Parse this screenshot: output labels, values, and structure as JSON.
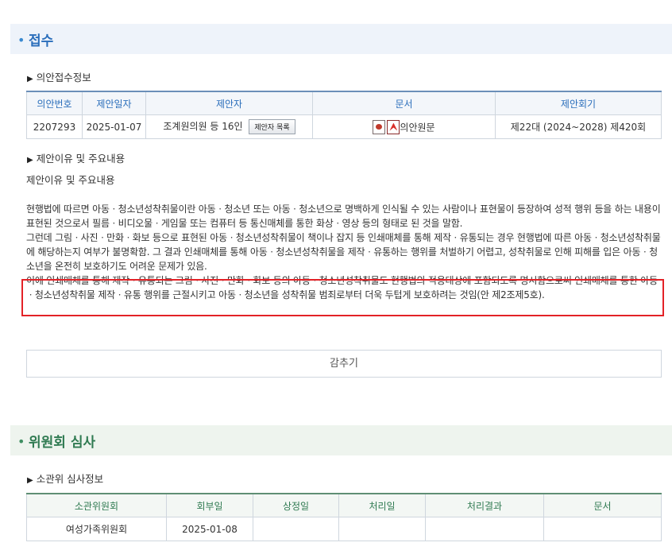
{
  "reception": {
    "heading": "접수",
    "subheading": "의안접수정보",
    "columns": [
      "의안번호",
      "제안일자",
      "제안자",
      "문서",
      "제안회기"
    ],
    "row": {
      "bill_no": "2207293",
      "date": "2025-01-07",
      "proposer": "조계원의원 등 16인",
      "proposer_btn": "제안자 목록",
      "document": "의안원문",
      "session": "제22대 (2024~2028) 제420회"
    }
  },
  "reason": {
    "subheading": "제안이유 및 주요내용",
    "label": "제안이유 및 주요내용",
    "para1": "현행법에 따르면 아동ㆍ청소년성착취물이란 아동ㆍ청소년 또는 아동ㆍ청소년으로 명백하게 인식될 수 있는 사람이나 표현물이 등장하여 성적 행위 등을 하는 내용이 표현된 것으로서 필름ㆍ비디오물ㆍ게임물 또는 컴퓨터 등 통신매체를 통한 화상ㆍ영상 등의 형태로 된 것을 말함.",
    "para2": "그런데 그림ㆍ사진ㆍ만화ㆍ화보 등으로 표현된 아동ㆍ청소년성착취물이 책이나 잡지 등 인쇄매체를 통해 제작ㆍ유통되는 경우 현행법에 따른 아동ㆍ청소년성착취물에 해당하는지 여부가 불명확함. 그 결과 인쇄매체를 통해 아동ㆍ청소년성착취물을 제작ㆍ유통하는 행위를 처벌하기 어렵고, 성착취물로 인해 피해를 입은 아동ㆍ청소년을 온전히 보호하기도 어려운 문제가 있음.",
    "para3": "이에 인쇄매체를 통해 제작ㆍ유통되는 그림ㆍ사진ㆍ만화ㆍ화보 등의 아동ㆍ청소년성착취물도 현행법의 적용대상에 포함되도록 명시함으로써 인쇄매체를 통한 아동ㆍ청소년성착취물 제작ㆍ유통 행위를 근절시키고 아동ㆍ청소년을 성착취물 범죄로부터 더욱 두텁게 보호하려는 것임(안 제2조제5호).",
    "hide_btn": "감추기"
  },
  "committee": {
    "heading": "위원회 심사",
    "subheading": "소관위 심사정보",
    "columns": [
      "소관위원회",
      "회부일",
      "상정일",
      "처리일",
      "처리결과",
      "문서"
    ],
    "row": {
      "committee": "여성가족위원회",
      "referral_date": "2025-01-08",
      "agenda_date": "",
      "process_date": "",
      "result": "",
      "document": ""
    }
  }
}
